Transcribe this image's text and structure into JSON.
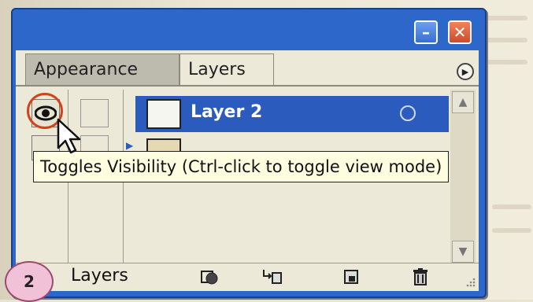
{
  "tabs": [
    {
      "label": "Appearance"
    },
    {
      "label": "Layers"
    }
  ],
  "layers": [
    {
      "name": "Layer 2",
      "selected": true
    }
  ],
  "tooltip": {
    "text": "Toggles Visibility (Ctrl-click to toggle view mode)"
  },
  "bottom_bar": {
    "count_label": "Layers"
  },
  "step_badge": {
    "number": "2"
  },
  "colors": {
    "title_bar": "#2d67c9",
    "selection": "#2a5bbd",
    "highlight_circle": "#d4421c",
    "badge": "#f1c2d7"
  },
  "icons": [
    "minimize-icon",
    "close-icon",
    "palette-menu-icon",
    "eye-icon",
    "cursor-icon",
    "make-clipping-mask-icon",
    "new-sublayer-icon",
    "new-layer-icon",
    "delete-icon"
  ]
}
